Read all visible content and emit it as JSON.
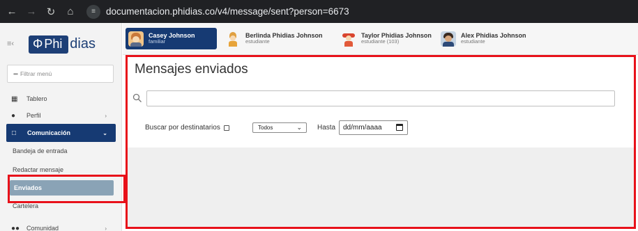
{
  "browser": {
    "url": "documentacion.phidias.co/v4/message/sent?person=6673",
    "back_icon": "arrow-left-icon",
    "forward_icon": "arrow-right-icon",
    "reload_icon": "reload-icon",
    "home_icon": "home-icon",
    "site_settings_icon": "tune-icon"
  },
  "sidebar": {
    "logo_phi": "Φ",
    "logo_part1": "Phi",
    "logo_part2": "dias",
    "filter_placeholder": "Filtrar menú",
    "items": [
      {
        "label": "Tablero",
        "icon": "dashboard-icon"
      },
      {
        "label": "Perfil",
        "icon": "person-icon",
        "has_chevron": true
      },
      {
        "label": "Comunicación",
        "icon": "message-icon",
        "active": true,
        "expanded": true
      },
      {
        "label": "Comunidad",
        "icon": "people-icon",
        "has_chevron": true
      }
    ],
    "sub_items": [
      {
        "label": "Bandeja de entrada"
      },
      {
        "label": "Redactar mensaje"
      },
      {
        "label": "Enviados",
        "selected": true
      },
      {
        "label": "Cartelera"
      }
    ]
  },
  "people": [
    {
      "name": "Casey Johnson",
      "role": "familiar",
      "active": true
    },
    {
      "name": "Berlinda Phidias Johnson",
      "role": "estudiante"
    },
    {
      "name": "Taylor Phidias Johnson",
      "role": "estudiante (103)"
    },
    {
      "name": "Alex Phidias Johnson",
      "role": "estudiante"
    }
  ],
  "main": {
    "title": "Mensajes enviados",
    "search_value": "",
    "recipients_label": "Buscar por destinatarios",
    "recipients_checked": false,
    "filter_selected": "Todos",
    "until_label": "Hasta",
    "date_placeholder": "dd/mm/aaaa"
  },
  "colors": {
    "primary": "#163a73",
    "selected_sub": "#8aa3b6",
    "highlight": "#e8111a"
  }
}
